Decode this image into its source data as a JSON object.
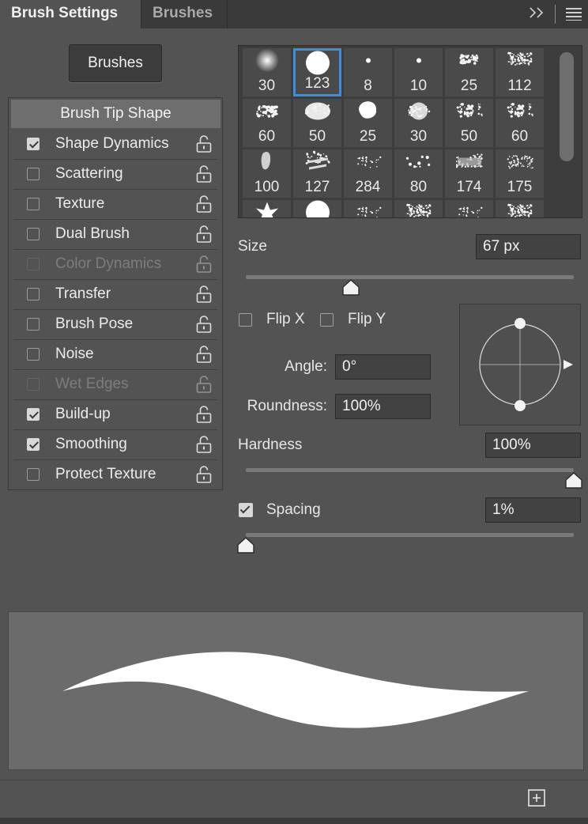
{
  "tabs": {
    "brush_settings": "Brush Settings",
    "brushes": "Brushes"
  },
  "brushes_button": "Brushes",
  "tip_shape": "Brush Tip Shape",
  "options": [
    {
      "label": "Shape Dynamics",
      "checked": true,
      "enabled": true
    },
    {
      "label": "Scattering",
      "checked": false,
      "enabled": true
    },
    {
      "label": "Texture",
      "checked": false,
      "enabled": true
    },
    {
      "label": "Dual Brush",
      "checked": false,
      "enabled": true
    },
    {
      "label": "Color Dynamics",
      "checked": false,
      "enabled": false
    },
    {
      "label": "Transfer",
      "checked": false,
      "enabled": true
    },
    {
      "label": "Brush Pose",
      "checked": false,
      "enabled": true
    },
    {
      "label": "Noise",
      "checked": false,
      "enabled": true
    },
    {
      "label": "Wet Edges",
      "checked": false,
      "enabled": false
    },
    {
      "label": "Build-up",
      "checked": true,
      "enabled": true
    },
    {
      "label": "Smoothing",
      "checked": true,
      "enabled": true
    },
    {
      "label": "Protect Texture",
      "checked": false,
      "enabled": true
    }
  ],
  "brush_presets": [
    {
      "size": "30",
      "shape": "soft"
    },
    {
      "size": "123",
      "shape": "hard",
      "selected": true
    },
    {
      "size": "8",
      "shape": "dot-small"
    },
    {
      "size": "10",
      "shape": "dot-small"
    },
    {
      "size": "25",
      "shape": "splatter"
    },
    {
      "size": "112",
      "shape": "texture"
    },
    {
      "size": "60",
      "shape": "sponge"
    },
    {
      "size": "50",
      "shape": "chalk"
    },
    {
      "size": "25",
      "shape": "blob"
    },
    {
      "size": "30",
      "shape": "fuzzy"
    },
    {
      "size": "50",
      "shape": "scatter"
    },
    {
      "size": "60",
      "shape": "scatter"
    },
    {
      "size": "100",
      "shape": "charcoal"
    },
    {
      "size": "127",
      "shape": "streak"
    },
    {
      "size": "284",
      "shape": "spray"
    },
    {
      "size": "80",
      "shape": "spray-coarse"
    },
    {
      "size": "174",
      "shape": "streak-wide"
    },
    {
      "size": "175",
      "shape": "hair"
    },
    {
      "size": "",
      "shape": "leaf"
    },
    {
      "size": "",
      "shape": "hard"
    },
    {
      "size": "",
      "shape": "spray"
    },
    {
      "size": "",
      "shape": "texture"
    },
    {
      "size": "",
      "shape": "spray"
    },
    {
      "size": "",
      "shape": "texture"
    }
  ],
  "size": {
    "label": "Size",
    "value": "67 px",
    "slider_fraction": 0.32
  },
  "flip_x": {
    "label": "Flip X",
    "checked": false
  },
  "flip_y": {
    "label": "Flip Y",
    "checked": false
  },
  "angle": {
    "label": "Angle:",
    "value": "0°"
  },
  "roundness": {
    "label": "Roundness:",
    "value": "100%"
  },
  "hardness": {
    "label": "Hardness",
    "value": "100%",
    "slider_fraction": 1.0
  },
  "spacing": {
    "label": "Spacing",
    "value": "1%",
    "checked": true,
    "slider_fraction": 0.0
  },
  "icons": {
    "collapse": "double-chevron-right-icon",
    "menu": "hamburger-menu-icon",
    "lock": "lock-open-icon",
    "new_brush": "new-brush-icon"
  },
  "colors": {
    "accent": "#3d8ee3",
    "panel": "#535353",
    "tab_bar": "#3a3a3a"
  }
}
